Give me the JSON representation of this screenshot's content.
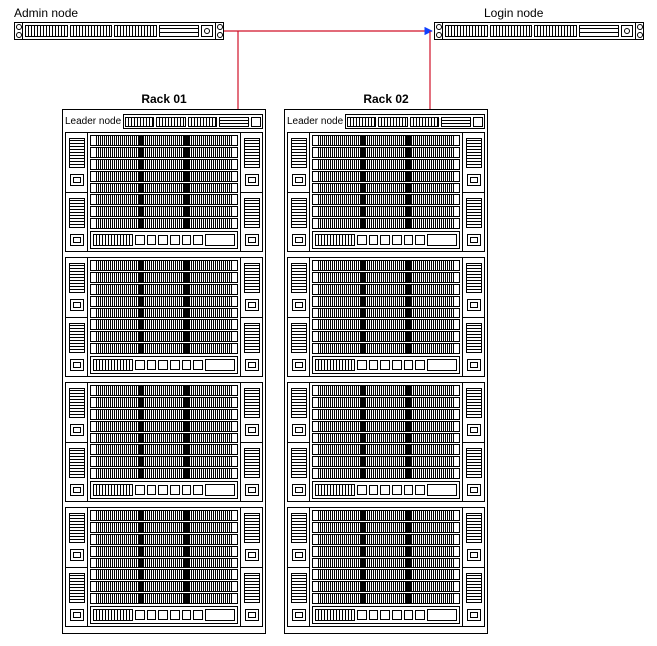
{
  "nodes": {
    "admin": {
      "label": "Admin node"
    },
    "login": {
      "label": "Login node"
    }
  },
  "racks": [
    {
      "title": "Rack 01",
      "leader_label": "Leader node"
    },
    {
      "title": "Rack 02",
      "leader_label": "Leader node"
    }
  ],
  "arrows": {
    "admin_to_login_color": "#d01028",
    "admin_to_login_tip_color": "#1040ff",
    "admin_to_racks_color": "#d01028"
  },
  "layout": {
    "blades_per_block": 8,
    "blocks_per_rack": 4
  }
}
